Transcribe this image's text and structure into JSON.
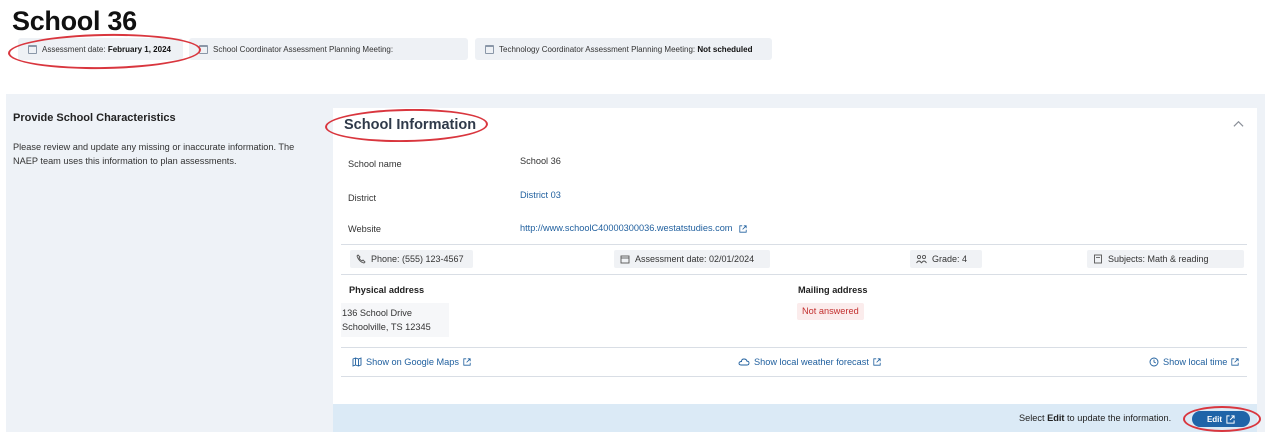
{
  "page": {
    "title": "School 36"
  },
  "chips": [
    {
      "label": "Assessment date: ",
      "value": "February 1, 2024"
    },
    {
      "label": "School Coordinator Assessment Planning Meeting:",
      "value": ""
    },
    {
      "label": "Technology Coordinator Assessment Planning Meeting: ",
      "value": "Not scheduled"
    }
  ],
  "left": {
    "title": "Provide School Characteristics",
    "description": "Please review and update any missing or inaccurate information. The NAEP team uses this information to plan assessments."
  },
  "card": {
    "title": "School Information",
    "fields": [
      {
        "label": "School name",
        "value": "School 36"
      },
      {
        "label": "District",
        "value": "District 03"
      },
      {
        "label": "Website",
        "value": "http://www.schoolC40000300036.westatstudies.com"
      }
    ],
    "info": {
      "phone": "Phone: (555) 123-4567",
      "assessment_date": "Assessment date: 02/01/2024",
      "grade": "Grade: 4",
      "subjects": "Subjects: Math & reading"
    },
    "physical": {
      "label": "Physical address",
      "line1": "136 School Drive",
      "line2": "Schoolville, TS 12345"
    },
    "mailing": {
      "label": "Mailing address",
      "value": "Not answered"
    },
    "links": {
      "maps": "Show on Google Maps",
      "weather": "Show local weather forecast",
      "time": "Show local time"
    }
  },
  "footer": {
    "text_pre": "Select ",
    "text_bold": "Edit",
    "text_post": " to update the information.",
    "edit_label": "Edit"
  },
  "colors": {
    "accent": "#1f64a8",
    "link": "#1f5f9e",
    "highlight": "#d9363e",
    "panel": "#eef2f7",
    "footer": "#dbeaf6"
  }
}
